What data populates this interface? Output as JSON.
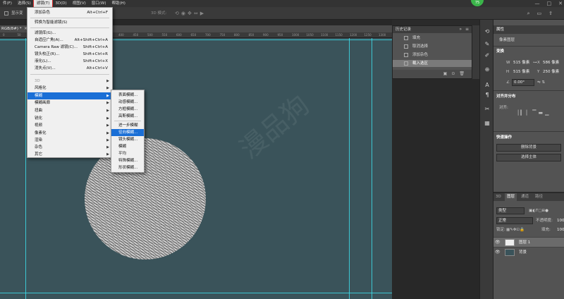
{
  "menubar": {
    "items": [
      "件(F)",
      "选择(S)",
      "滤镜(T)",
      "3D(D)",
      "视图(V)",
      "窗口(W)",
      "帮助(H)"
    ],
    "active_index": 2,
    "badge": "75"
  },
  "optbar": {
    "show_transform_label": "显示变",
    "mode_3d": "3D 模式:"
  },
  "document": {
    "tab_title": "RGB/8#) *",
    "ruler_ticks": [
      "0",
      "50",
      "100",
      "150",
      "200",
      "250",
      "300",
      "350",
      "400",
      "450",
      "500",
      "550",
      "600",
      "650",
      "700",
      "750",
      "800",
      "850",
      "900",
      "950",
      "1000",
      "1050",
      "1100",
      "1150",
      "1200",
      "1250",
      "1300"
    ]
  },
  "filter_menu": {
    "items": [
      {
        "label": "添加杂色",
        "shortcut": "Alt+Ctrl+F"
      },
      {
        "label": "转换为智能滤镜(S)",
        "shortcut": ""
      },
      {
        "label": "滤镜库(G)...",
        "shortcut": ""
      },
      {
        "label": "自适应广角(A)...",
        "shortcut": "Alt+Shift+Ctrl+A"
      },
      {
        "label": "Camera Raw 滤镜(C)...",
        "shortcut": "Shift+Ctrl+A"
      },
      {
        "label": "镜头校正(R)...",
        "shortcut": "Shift+Ctrl+R"
      },
      {
        "label": "液化(L)...",
        "shortcut": "Shift+Ctrl+X"
      },
      {
        "label": "消失点(V)...",
        "shortcut": "Alt+Ctrl+V"
      },
      {
        "label": "3D",
        "shortcut": ""
      },
      {
        "label": "风格化",
        "shortcut": ""
      },
      {
        "label": "模糊",
        "shortcut": ""
      },
      {
        "label": "模糊画廊",
        "shortcut": ""
      },
      {
        "label": "扭曲",
        "shortcut": ""
      },
      {
        "label": "锐化",
        "shortcut": ""
      },
      {
        "label": "视频",
        "shortcut": ""
      },
      {
        "label": "像素化",
        "shortcut": ""
      },
      {
        "label": "渲染",
        "shortcut": ""
      },
      {
        "label": "杂色",
        "shortcut": ""
      },
      {
        "label": "其它",
        "shortcut": ""
      }
    ]
  },
  "blur_submenu": {
    "items": [
      "表面模糊...",
      "动感模糊...",
      "方框模糊...",
      "高斯模糊...",
      "进一步模糊",
      "径向模糊...",
      "镜头模糊...",
      "模糊",
      "平均",
      "特殊模糊...",
      "形状模糊..."
    ]
  },
  "history": {
    "title": "历史记录",
    "rows": [
      "填充",
      "取消选择",
      "添加杂色",
      "载入选区"
    ],
    "selected_index": 3
  },
  "properties": {
    "tab": "属性",
    "subtitle": "像素图层",
    "transform": {
      "title": "变换",
      "w_label": "W",
      "w_value": "515 像素",
      "h_label": "H",
      "h_value": "515 像素",
      "x_label": "X",
      "x_value": "586 像素",
      "y_label": "Y",
      "y_value": "250 像素",
      "angle": "0.00°"
    },
    "align": {
      "title": "对齐并分布",
      "label": "对齐:"
    },
    "quick_actions": {
      "title": "快速操作",
      "btn1": "删除背景",
      "btn2": "选择主体"
    }
  },
  "layers": {
    "tabs": [
      "3D",
      "图层",
      "通道",
      "路径"
    ],
    "active_tab": 1,
    "kind_label": "类型",
    "blend_mode": "正常",
    "opacity_label": "不透明度:",
    "opacity_value": "100",
    "lock_label": "锁定:",
    "fill_label": "填充:",
    "fill_value": "100",
    "items": [
      {
        "name": "图层 1",
        "selected": true
      },
      {
        "name": "背景",
        "selected": false
      }
    ]
  },
  "colors": {
    "canvas": "#3a535a",
    "guide": "#3de3f0",
    "highlight": "#1a6fd6"
  }
}
